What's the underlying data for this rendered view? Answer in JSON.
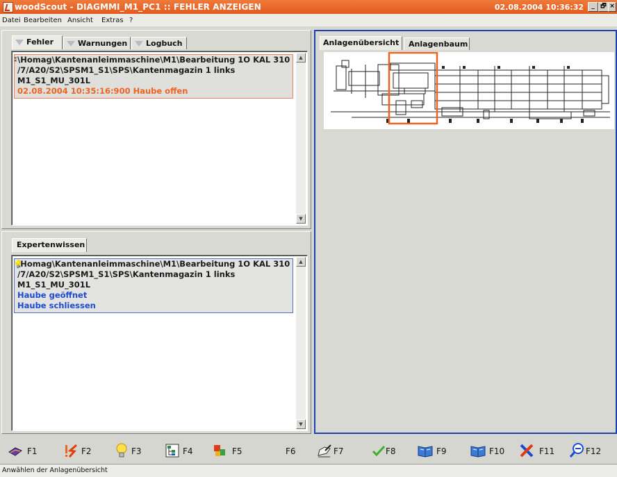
{
  "window": {
    "title": "woodScout - DIAGMMI_M1_PC1 :: FEHLER ANZEIGEN",
    "datetime": "02.08.2004 10:36:32",
    "controls": {
      "minimize": "_",
      "restore": "🗗",
      "close": "×"
    }
  },
  "menu": [
    "Datei",
    "Bearbeiten",
    "Ansicht",
    "Extras",
    "?"
  ],
  "error_panel": {
    "tabs": [
      {
        "label": "Fehler",
        "icon": "funnel-icon",
        "active": true
      },
      {
        "label": "Warnungen",
        "icon": "funnel-icon",
        "active": false
      },
      {
        "label": "Logbuch",
        "icon": "funnel-icon",
        "active": false
      }
    ],
    "entry": {
      "line1": "\\Homag\\Kantenanleimmaschine\\M1\\Bearbeitung 1O KAL 310",
      "line2": "/7/A20/S2\\SPSM1_S1\\SPS\\Kantenmagazin 1 links",
      "line3": "M1_S1_MU_301L",
      "message": "02.08.2004 10:35:16:900  Haube offen"
    }
  },
  "expert_panel": {
    "tab": "Expertenwissen",
    "entry": {
      "line1": "\\Homag\\Kantenanleimmaschine\\M1\\Bearbeitung 1O KAL 310",
      "line2": "/7/A20/S2\\SPSM1_S1\\SPS\\Kantenmagazin 1 links",
      "line3": "M1_S1_MU_301L",
      "hint1": "Haube geöffnet",
      "hint2": "Haube schliessen"
    }
  },
  "plant_panel": {
    "tabs": [
      {
        "label": "Anlagenübersicht",
        "active": true
      },
      {
        "label": "Anlagenbaum",
        "active": false
      }
    ]
  },
  "function_keys": [
    {
      "key": "F1",
      "icon": "book-icon"
    },
    {
      "key": "F2",
      "icon": "error-flash-icon"
    },
    {
      "key": "F3",
      "icon": "lightbulb-icon"
    },
    {
      "key": "F4",
      "icon": "tree-view-icon"
    },
    {
      "key": "F5",
      "icon": "cubes-icon"
    },
    {
      "key": "F6",
      "icon": ""
    },
    {
      "key": "F7",
      "icon": "writing-hand-icon"
    },
    {
      "key": "F8",
      "icon": "checkmark-icon"
    },
    {
      "key": "F9",
      "icon": "open-book-icon"
    },
    {
      "key": "F10",
      "icon": "open-book-icon"
    },
    {
      "key": "F11",
      "icon": "cross-tool-icon"
    },
    {
      "key": "F12",
      "icon": "zoom-out-icon"
    }
  ],
  "status": "Anwählen der Anlagenübersicht",
  "colors": {
    "title_orange": "#e55a1e",
    "error_text": "#f0621f",
    "hint_blue": "#1b4bd0",
    "frame_blue": "#1b40b0"
  }
}
